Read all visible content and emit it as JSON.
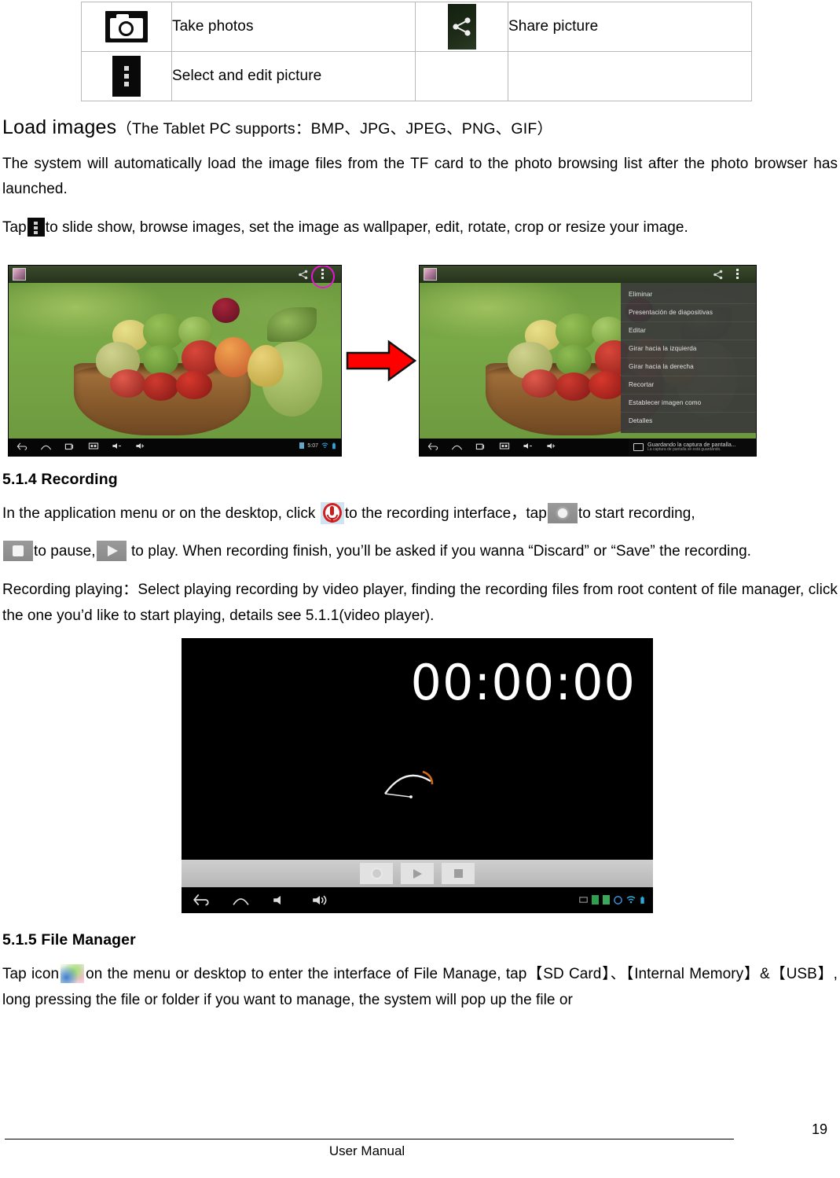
{
  "table": {
    "rows": [
      {
        "icon1": "camera-icon",
        "label1": "Take photos",
        "icon2": "share-icon",
        "label2": "Share picture"
      },
      {
        "icon1": "overflow-menu-icon",
        "label1": "Select and edit picture",
        "icon2": "",
        "label2": ""
      }
    ]
  },
  "load_images": {
    "heading_main": "Load images",
    "heading_rest": "（The Tablet PC supports：BMP、JPG、JPEG、PNG、GIF）",
    "paragraph1": "The system will automatically load the image files from the TF card to the photo browsing list after the photo browser has launched.",
    "tap_prefix": "Tap",
    "tap_suffix": "to slide show, browse images, set the image as wallpaper, edit, rotate, crop or resize your image."
  },
  "gallery_figure": {
    "left_caption": "",
    "menu_items": [
      "Eliminar",
      "Presentación de diapositivas",
      "Editar",
      "Girar hacia la izquierda",
      "Girar hacia la derecha",
      "Recortar",
      "Establecer imagen como",
      "Detalles"
    ],
    "save_toast_title": "Guardando la captura de pantalla...",
    "save_toast_sub": "La captura de pantalla se está guardando.",
    "clock": "5:07"
  },
  "recording": {
    "section_title": "5.1.4 Recording",
    "p1_a": "In the application menu or on the desktop, click",
    "p1_b": "to the recording interface，tap",
    "p1_c": "to start recording,",
    "p2_a": "to pause,",
    "p2_b": "to play. When recording finish, you’ll be asked if you wanna “Discard” or “Save” the recording.",
    "p3": "Recording playing：Select playing recording by video player, finding the recording files from root content of file manager, click the one you’d like to start playing, details see 5.1.1(video player).",
    "recorder_timer": "00:00:00"
  },
  "file_manager": {
    "section_title": "5.1.5 File Manager",
    "p_a": "Tap icon",
    "p_b": "on the menu or desktop to enter the interface of File Manage, tap【SD Card】、【Internal Memory】&【USB】, long pressing the file or folder if you want to manage, the system will pop up the file or"
  },
  "footer": {
    "doc_name": "User Manual",
    "page_number": "19"
  },
  "colors": {
    "accent_arrow": "#ff0000",
    "highlight_ring": "#e815d2",
    "table_border": "#b9b9b9"
  }
}
